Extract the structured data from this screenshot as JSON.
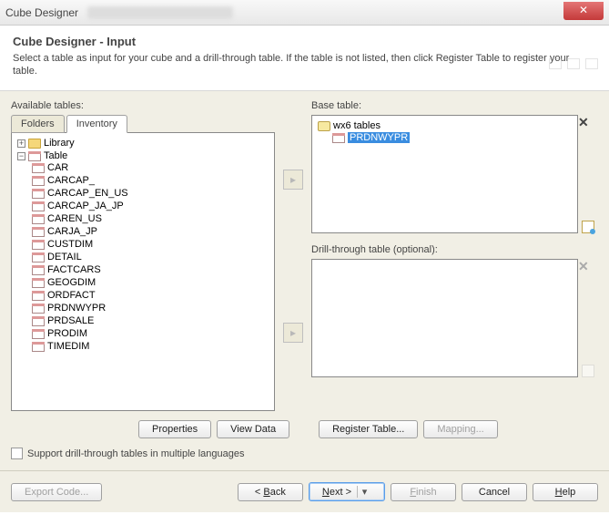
{
  "window": {
    "title": "Cube Designer"
  },
  "header": {
    "title": "Cube Designer - Input",
    "subtitle": "Select a table as input for your cube and a drill-through table. If the table is not listed, then click Register Table to register your table."
  },
  "available": {
    "label": "Available tables:",
    "tabs": {
      "folders": "Folders",
      "inventory": "Inventory"
    },
    "library_label": "Library",
    "table_label": "Table",
    "items": [
      "CAR",
      "CARCAP_",
      "CARCAP_EN_US",
      "CARCAP_JA_JP",
      "CAREN_US",
      "CARJA_JP",
      "CUSTDIM",
      "DETAIL",
      "FACTCARS",
      "GEOGDIM",
      "ORDFACT",
      "PRDNWYPR",
      "PRDSALE",
      "PRODIM",
      "TIMEDIM"
    ]
  },
  "base": {
    "label": "Base table:",
    "root": "wx6 tables",
    "selected": "PRDNWYPR"
  },
  "drill": {
    "label": "Drill-through table (optional):"
  },
  "buttons": {
    "properties": "Properties",
    "view_data": "View Data",
    "register": "Register Table...",
    "mapping": "Mapping..."
  },
  "checkbox": {
    "label": "Support drill-through tables in multiple languages"
  },
  "footer": {
    "export": "Export Code...",
    "back": "< Back",
    "next": "Next >",
    "finish": "Finish",
    "cancel": "Cancel",
    "help": "Help"
  }
}
